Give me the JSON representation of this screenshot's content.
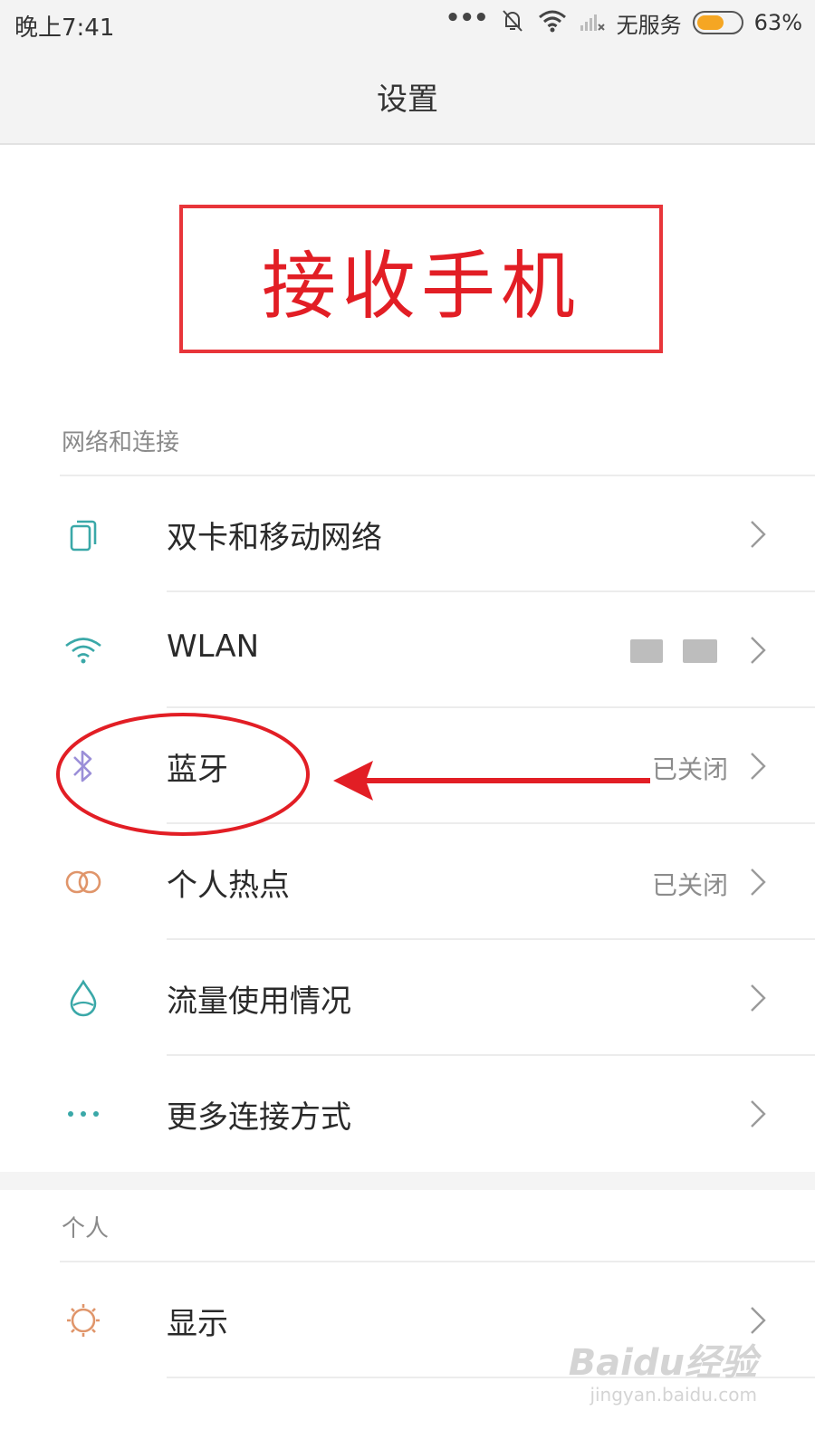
{
  "status_bar": {
    "time": "晚上7:41",
    "dots": "•••",
    "carrier": "无服务",
    "battery_percent_text": "63%",
    "battery_level": 0.63,
    "battery_color": "#f5a623"
  },
  "header": {
    "title": "设置"
  },
  "annotation": {
    "banner_text": "接收手机",
    "color": "#e21e25"
  },
  "sections": {
    "network": {
      "label": "网络和连接",
      "items": [
        {
          "label": "双卡和移动网络",
          "value": "",
          "icon": "dual-sim-icon"
        },
        {
          "label": "WLAN",
          "value": "",
          "icon": "wifi-icon"
        },
        {
          "label": "蓝牙",
          "value": "已关闭",
          "icon": "bluetooth-icon"
        },
        {
          "label": "个人热点",
          "value": "已关闭",
          "icon": "hotspot-icon"
        },
        {
          "label": "流量使用情况",
          "value": "",
          "icon": "data-usage-icon"
        },
        {
          "label": "更多连接方式",
          "value": "",
          "icon": "more-icon"
        }
      ]
    },
    "personal": {
      "label": "个人",
      "items": [
        {
          "label": "显示",
          "value": "",
          "icon": "display-icon"
        }
      ]
    }
  },
  "watermark": {
    "text": "Baidu经验",
    "sub": "jingyan.baidu.com"
  },
  "colors": {
    "icon_teal": "#3aa8a8",
    "icon_purple": "#9b8fd8",
    "icon_orange": "#e0956a",
    "annotation_red": "#e21e25"
  }
}
